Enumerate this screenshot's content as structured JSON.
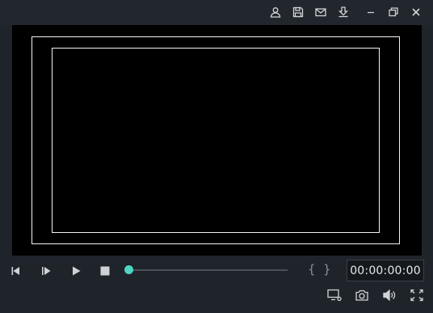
{
  "titlebar": {
    "icons": [
      "account-icon",
      "save-icon",
      "mail-icon",
      "download-icon",
      "minimize-icon",
      "restore-icon",
      "close-icon"
    ]
  },
  "player": {
    "timecode": "00:00:00:00",
    "mark_in": "{",
    "mark_out": "}",
    "progress": 0,
    "colors": {
      "accent": "#4fd5c4",
      "background": "#1f242b",
      "preview": "#000000"
    }
  }
}
